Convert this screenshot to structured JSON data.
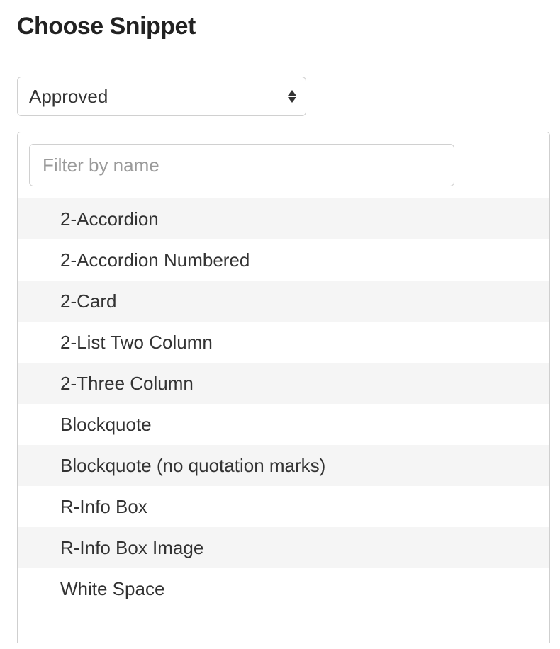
{
  "header": {
    "title": "Choose Snippet"
  },
  "filter": {
    "selected": "Approved",
    "placeholder": "Filter by name"
  },
  "snippets": [
    {
      "label": "2-Accordion"
    },
    {
      "label": "2-Accordion Numbered"
    },
    {
      "label": "2-Card"
    },
    {
      "label": "2-List Two Column"
    },
    {
      "label": "2-Three Column"
    },
    {
      "label": "Blockquote"
    },
    {
      "label": "Blockquote (no quotation marks)"
    },
    {
      "label": "R-Info Box"
    },
    {
      "label": "R-Info Box Image"
    },
    {
      "label": "White Space"
    }
  ]
}
